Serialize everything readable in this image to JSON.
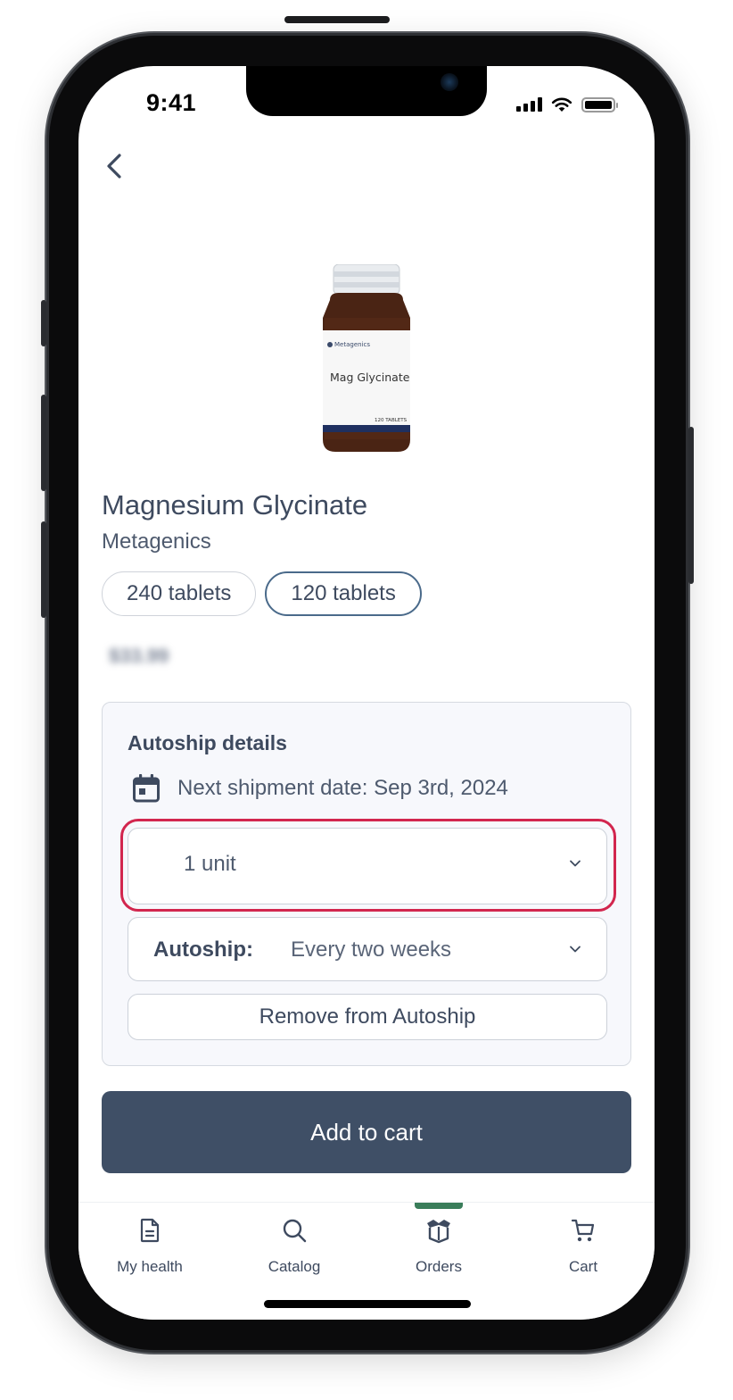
{
  "status_bar": {
    "time": "9:41"
  },
  "navigation": {
    "back_icon": "chevron-left-icon"
  },
  "product": {
    "image_label": "Mag Glycinate",
    "image_brand": "Metagenics",
    "image_count": "120 TABLETS",
    "name": "Magnesium Glycinate",
    "brand": "Metagenics",
    "sizes": [
      {
        "label": "240 tablets",
        "selected": false
      },
      {
        "label": "120 tablets",
        "selected": true
      }
    ],
    "price": "$33.99"
  },
  "autoship": {
    "title": "Autoship details",
    "calendar_icon": "calendar-icon",
    "next_shipment": "Next shipment date: Sep 3rd, 2024",
    "quantity_value": "1 unit",
    "frequency_label": "Autoship:",
    "frequency_value": "Every two weeks",
    "remove_label": "Remove from Autoship"
  },
  "add_to_cart_label": "Add to cart",
  "tabbar": {
    "items": [
      {
        "label": "My health",
        "icon": "document-icon",
        "active": false
      },
      {
        "label": "Catalog",
        "icon": "search-icon",
        "active": false
      },
      {
        "label": "Orders",
        "icon": "box-icon",
        "active": true
      },
      {
        "label": "Cart",
        "icon": "cart-icon",
        "active": false
      }
    ]
  },
  "colors": {
    "primary": "#3f4f66",
    "highlight": "#d2264e",
    "active_tab": "#3a7d5a",
    "selected_chip_border": "#4a6a8a"
  }
}
